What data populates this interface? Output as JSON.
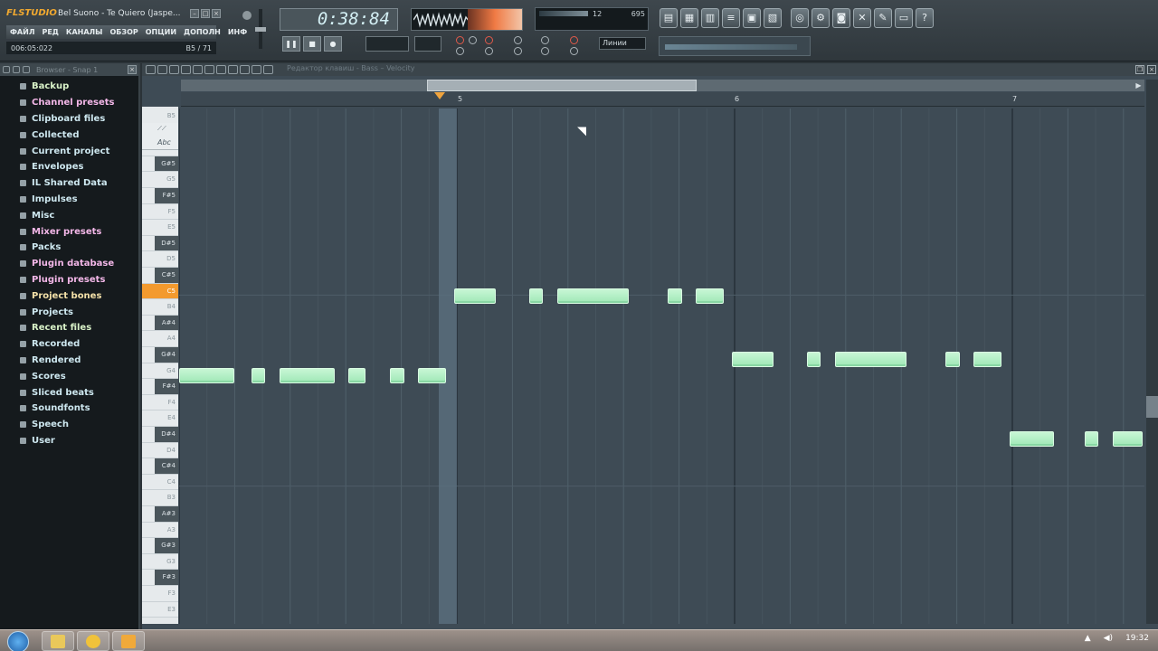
{
  "app": {
    "logo": "FLSTUDIO",
    "song_title": "Bel Suono - Te Quiero (Jaspe...",
    "window_buttons": [
      "–",
      "□",
      "×"
    ],
    "menus": [
      "ФАЙЛ",
      "РЕД",
      "КАНАЛЫ",
      "ОБЗОР",
      "ОПЦИИ",
      "ДОПОЛН",
      "ИНФ"
    ],
    "position_readout": "006:05:022",
    "bar_readout": "B5 / 71"
  },
  "transport": {
    "time": "0:38:84",
    "buttons": [
      "❚❚",
      "■",
      "●"
    ],
    "snap_value": "Линии",
    "cpu_left": "12",
    "cpu_right": "695"
  },
  "toolbar_icons": [
    "playlist-icon",
    "step-sequencer-icon",
    "piano-roll-icon",
    "mixer-icon",
    "browser-icon",
    "channel-rack-icon",
    "online-icon",
    "render-icon",
    "plugin-icon",
    "effects-icon",
    "tools-icon",
    "notes-icon",
    "help-icon"
  ],
  "browser": {
    "title": "Browser - Snap 1",
    "items": [
      {
        "label": "Backup",
        "color": "#d9f2c8"
      },
      {
        "label": "Channel presets",
        "color": "#f3b7e8"
      },
      {
        "label": "Clipboard files",
        "color": "#cde7ef"
      },
      {
        "label": "Collected",
        "color": "#cde7ef"
      },
      {
        "label": "Current project",
        "color": "#cde7ef"
      },
      {
        "label": "Envelopes",
        "color": "#cde7ef"
      },
      {
        "label": "IL Shared Data",
        "color": "#cde7ef"
      },
      {
        "label": "Impulses",
        "color": "#cde7ef"
      },
      {
        "label": "Misc",
        "color": "#cde7ef"
      },
      {
        "label": "Mixer presets",
        "color": "#f3b7e8"
      },
      {
        "label": "Packs",
        "color": "#cde7ef"
      },
      {
        "label": "Plugin database",
        "color": "#f3b7e8"
      },
      {
        "label": "Plugin presets",
        "color": "#f3b7e8"
      },
      {
        "label": "Project bones",
        "color": "#f3e0a8"
      },
      {
        "label": "Projects",
        "color": "#cde7ef"
      },
      {
        "label": "Recent files",
        "color": "#d9f2c8"
      },
      {
        "label": "Recorded",
        "color": "#cde7ef"
      },
      {
        "label": "Rendered",
        "color": "#cde7ef"
      },
      {
        "label": "Scores",
        "color": "#cde7ef"
      },
      {
        "label": "Sliced beats",
        "color": "#cde7ef"
      },
      {
        "label": "Soundfonts",
        "color": "#cde7ef"
      },
      {
        "label": "Speech",
        "color": "#cde7ef"
      },
      {
        "label": "User",
        "color": "#cde7ef"
      }
    ]
  },
  "piano_roll": {
    "title": "Редактор клавиш - Bass",
    "control": "Velocity",
    "abc_label": "Abc",
    "bar_numbers": [
      "5",
      "6",
      "7"
    ],
    "keys": [
      "B5",
      "A#5",
      "A5",
      "G#5",
      "G5",
      "F#5",
      "F5",
      "E5",
      "D#5",
      "D5",
      "C#5",
      "C5",
      "B4",
      "A#4",
      "A4",
      "G#4",
      "G4",
      "F#4",
      "F4",
      "E4",
      "D#4",
      "D4",
      "C#4",
      "C4",
      "B3",
      "A#3",
      "A3",
      "G#3",
      "G3",
      "F#3",
      "F3",
      "E3"
    ],
    "highlight_key": "C5",
    "notes": [
      {
        "key": "G4",
        "start_step": 0,
        "length": 2
      },
      {
        "key": "G4",
        "start_step": 2.6,
        "length": 0.5
      },
      {
        "key": "G4",
        "start_step": 3.6,
        "length": 2
      },
      {
        "key": "G4",
        "start_step": 6.1,
        "length": 0.6
      },
      {
        "key": "G4",
        "start_step": 7.6,
        "length": 0.5
      },
      {
        "key": "G4",
        "start_step": 8.6,
        "length": 1
      },
      {
        "key": "C5",
        "start_step": 9.9,
        "length": 1.5
      },
      {
        "key": "C5",
        "start_step": 12.6,
        "length": 0.5
      },
      {
        "key": "C5",
        "start_step": 13.6,
        "length": 2.6
      },
      {
        "key": "C5",
        "start_step": 17.6,
        "length": 0.5
      },
      {
        "key": "C5",
        "start_step": 18.6,
        "length": 1
      },
      {
        "key": "G#4",
        "start_step": 19.9,
        "length": 1.5
      },
      {
        "key": "G#4",
        "start_step": 22.6,
        "length": 0.5
      },
      {
        "key": "G#4",
        "start_step": 23.6,
        "length": 2.6
      },
      {
        "key": "G#4",
        "start_step": 27.6,
        "length": 0.5
      },
      {
        "key": "G#4",
        "start_step": 28.6,
        "length": 1
      },
      {
        "key": "D#4",
        "start_step": 29.9,
        "length": 1.6
      },
      {
        "key": "D#4",
        "start_step": 32.6,
        "length": 0.5
      },
      {
        "key": "D#4",
        "start_step": 33.6,
        "length": 1.1
      }
    ]
  },
  "taskbar": {
    "clock": "19:32",
    "apps": [
      "explorer",
      "norton",
      "fl-studio"
    ]
  }
}
